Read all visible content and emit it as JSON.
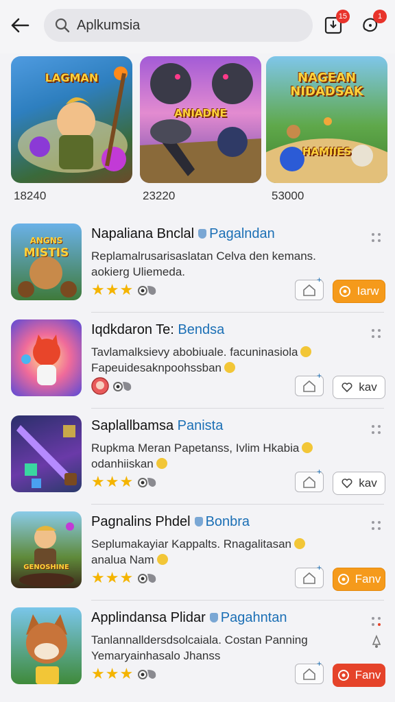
{
  "search": {
    "value": "Aplkumsia"
  },
  "header": {
    "badge1": "15",
    "badge2": "1"
  },
  "featured": [
    {
      "title": "LAGMAN",
      "count": "18240"
    },
    {
      "title": "ANIADNE",
      "count": "23220"
    },
    {
      "title_line1": "NAGEAN",
      "title_line2": "NIDADSAK",
      "subtitle": "HAMIIES",
      "count": "53000"
    }
  ],
  "thumb_labels": {
    "row1_line1": "ANGNS",
    "row1_line2": "MISTIS",
    "row4": "GENOSHINE"
  },
  "rows": [
    {
      "title": "Napaliana Bnclal",
      "highlight": "Pagalndan",
      "desc": "Replamalrusarisaslatan Celva den kemans. aokierg Uliemeda.",
      "action": "Iarw"
    },
    {
      "title": "Iqdkdaron Te:",
      "highlight": "Bendsa",
      "desc_line1": "Tavlamalksievy abobiuale. facuninasiola",
      "desc_line2": "Fapeuidesaknpoohssban",
      "action": "kav"
    },
    {
      "title": "Saplallbamsa",
      "highlight": "Panista",
      "desc_line1": "Rupkma Meran Papetanss, Ivlim Hkabia",
      "desc_line2": "odanhiiskan",
      "action": "kav"
    },
    {
      "title": "Pagnalins Phdel",
      "highlight": "Bonbra",
      "desc_line1": "Seplumakayiar Kappalts. Rnagalitasan",
      "desc_line2": "analua Nam",
      "action": "Fanv"
    },
    {
      "title": "Applindansa Plidar",
      "highlight": "Pagahntan",
      "desc_line1": "Tanlannalldersdsolcaiala. Costan Panning",
      "desc_line2": "Yemaryainhasalo Jhanss",
      "action": "Fanv"
    }
  ],
  "colors": {
    "accent_blue": "#1b6fb5",
    "orange": "#f59a1b",
    "red": "#e5432a",
    "star": "#f4b400"
  },
  "icons": [
    "back-arrow-icon",
    "search-icon",
    "download-icon",
    "notification-icon",
    "shield-icon",
    "star-icon",
    "home-icon",
    "heart-icon",
    "coin-icon",
    "more-icon"
  ]
}
